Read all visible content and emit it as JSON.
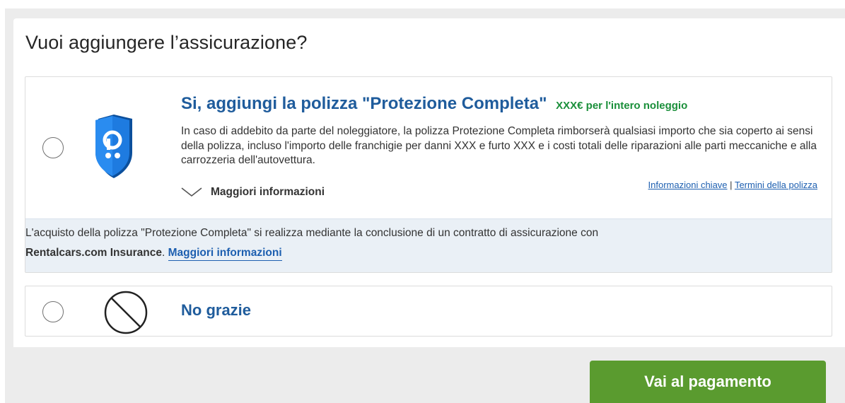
{
  "page": {
    "title": "Vuoi aggiungere l’assicurazione?"
  },
  "option_full": {
    "title": "Si, aggiungi la polizza \"Protezione Completa\"",
    "price": "XXX€ per l'intero noleggio",
    "description": "In caso di addebito da parte del noleggiatore, la polizza Protezione Completa rimborserà qualsiasi importo che sia coperto ai sensi della polizza, incluso l'importo delle franchigie per danni XXX e furto XXX e i costi totali delle riparazioni alle parti meccaniche e alla carrozzeria dell'autovettura.",
    "more_info_label": "Maggiori informazioni",
    "key_info_link": "Informazioni chiave",
    "separator": "|",
    "terms_link": "Termini della polizza",
    "icon": "shield-icon"
  },
  "info_strip": {
    "text": "L'acquisto della polizza \"Protezione Completa\" si realizza mediante la conclusione di un contratto di assicurazione con",
    "insurer": "Rentalcars.com Insurance",
    "period": ".",
    "link": "Maggiori informazioni"
  },
  "option_none": {
    "label": "No grazie",
    "icon": "prohibited-icon"
  },
  "footer": {
    "pay_button": "Vai al pagamento"
  },
  "colors": {
    "brand_blue": "#1f5c9c",
    "link_blue": "#1d5fb0",
    "price_green": "#1a8f3a",
    "button_green": "#5a9b2f",
    "info_bg": "#eaf0f6"
  }
}
